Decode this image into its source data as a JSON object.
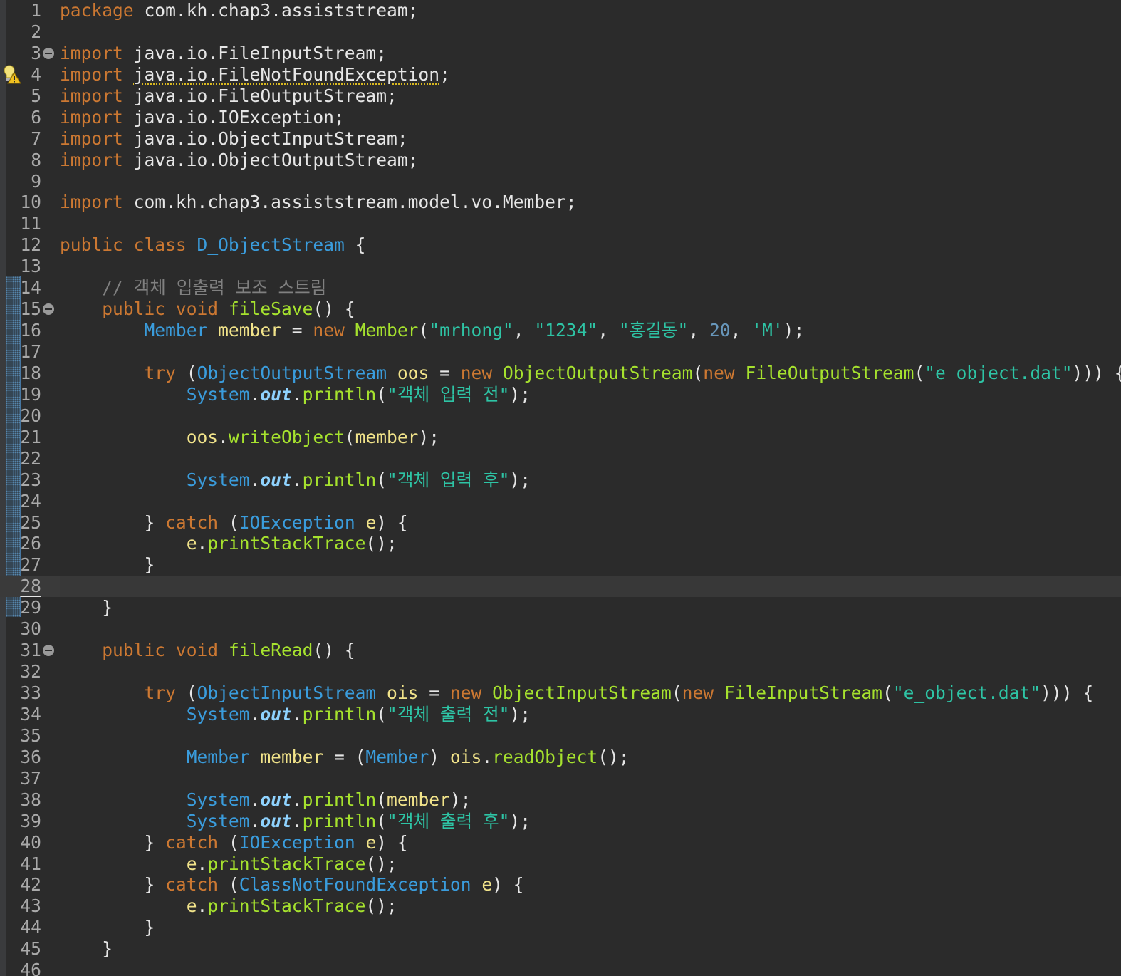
{
  "editor": {
    "language": "java",
    "file_warning_icon": "warning-lightbulb-icon",
    "current_line": 28,
    "folded_lines": [
      3,
      15,
      31
    ],
    "warning_line": 4,
    "colors": {
      "background": "#2b2b2b",
      "keyword": "#cc7832",
      "type": "#3a9cdc",
      "method": "#a6e22e",
      "variable": "#f1e38a",
      "string": "#2ec4a5",
      "number": "#6897bb",
      "comment": "#808080",
      "plain": "#e6e6e6",
      "line_number": "#aaaaaa"
    },
    "lines": [
      {
        "n": "1",
        "tokens": [
          [
            "kw",
            "package"
          ],
          [
            "plain",
            " com.kh.chap3.assiststream;"
          ]
        ]
      },
      {
        "n": "2",
        "tokens": []
      },
      {
        "n": "3",
        "tokens": [
          [
            "kw",
            "import"
          ],
          [
            "plain",
            " java.io.FileInputStream;"
          ]
        ]
      },
      {
        "n": "4",
        "tokens": [
          [
            "kw",
            "import"
          ],
          [
            "plain",
            " "
          ],
          [
            "warn",
            "java.io.FileNotFoundException"
          ],
          [
            "plain",
            ";"
          ]
        ]
      },
      {
        "n": "5",
        "tokens": [
          [
            "kw",
            "import"
          ],
          [
            "plain",
            " java.io.FileOutputStream;"
          ]
        ]
      },
      {
        "n": "6",
        "tokens": [
          [
            "kw",
            "import"
          ],
          [
            "plain",
            " java.io.IOException;"
          ]
        ]
      },
      {
        "n": "7",
        "tokens": [
          [
            "kw",
            "import"
          ],
          [
            "plain",
            " java.io.ObjectInputStream;"
          ]
        ]
      },
      {
        "n": "8",
        "tokens": [
          [
            "kw",
            "import"
          ],
          [
            "plain",
            " java.io.ObjectOutputStream;"
          ]
        ]
      },
      {
        "n": "9",
        "tokens": []
      },
      {
        "n": "10",
        "tokens": [
          [
            "kw",
            "import"
          ],
          [
            "plain",
            " com.kh.chap3.assiststream.model.vo.Member;"
          ]
        ]
      },
      {
        "n": "11",
        "tokens": []
      },
      {
        "n": "12",
        "tokens": [
          [
            "kw",
            "public"
          ],
          [
            "plain",
            " "
          ],
          [
            "kw",
            "class"
          ],
          [
            "plain",
            " "
          ],
          [
            "decl",
            "D_ObjectStream"
          ],
          [
            "plain",
            " {"
          ]
        ]
      },
      {
        "n": "13",
        "tokens": []
      },
      {
        "n": "14",
        "tokens": [
          [
            "plain",
            "    "
          ],
          [
            "comment",
            "// 객체 입출력 보조 스트림"
          ]
        ]
      },
      {
        "n": "15",
        "tokens": [
          [
            "plain",
            "    "
          ],
          [
            "kw",
            "public"
          ],
          [
            "plain",
            " "
          ],
          [
            "kw",
            "void"
          ],
          [
            "plain",
            " "
          ],
          [
            "methoddecl",
            "fileSave"
          ],
          [
            "plain",
            "() {"
          ]
        ]
      },
      {
        "n": "16",
        "tokens": [
          [
            "plain",
            "        "
          ],
          [
            "type",
            "Member"
          ],
          [
            "plain",
            " "
          ],
          [
            "var",
            "member"
          ],
          [
            "plain",
            " = "
          ],
          [
            "kw",
            "new"
          ],
          [
            "plain",
            " "
          ],
          [
            "method",
            "Member"
          ],
          [
            "plain",
            "("
          ],
          [
            "str",
            "\"mrhong\""
          ],
          [
            "plain",
            ", "
          ],
          [
            "str",
            "\"1234\""
          ],
          [
            "plain",
            ", "
          ],
          [
            "str",
            "\"홍길동\""
          ],
          [
            "plain",
            ", "
          ],
          [
            "num",
            "20"
          ],
          [
            "plain",
            ", "
          ],
          [
            "str",
            "'M'"
          ],
          [
            "plain",
            ");"
          ]
        ]
      },
      {
        "n": "17",
        "tokens": []
      },
      {
        "n": "18",
        "tokens": [
          [
            "plain",
            "        "
          ],
          [
            "kw",
            "try"
          ],
          [
            "plain",
            " ("
          ],
          [
            "type",
            "ObjectOutputStream"
          ],
          [
            "plain",
            " "
          ],
          [
            "var",
            "oos"
          ],
          [
            "plain",
            " = "
          ],
          [
            "kw",
            "new"
          ],
          [
            "plain",
            " "
          ],
          [
            "method",
            "ObjectOutputStream"
          ],
          [
            "plain",
            "("
          ],
          [
            "kw",
            "new"
          ],
          [
            "plain",
            " "
          ],
          [
            "method",
            "FileOutputStream"
          ],
          [
            "plain",
            "("
          ],
          [
            "str",
            "\"e_object.dat\""
          ],
          [
            "plain",
            ")))"
          ],
          [
            "plain",
            " {"
          ]
        ]
      },
      {
        "n": "19",
        "tokens": [
          [
            "plain",
            "            "
          ],
          [
            "type",
            "System"
          ],
          [
            "plain",
            "."
          ],
          [
            "field",
            "out"
          ],
          [
            "plain",
            "."
          ],
          [
            "method",
            "println"
          ],
          [
            "plain",
            "("
          ],
          [
            "str",
            "\"객체 입력 전\""
          ],
          [
            "plain",
            ");"
          ]
        ]
      },
      {
        "n": "20",
        "tokens": []
      },
      {
        "n": "21",
        "tokens": [
          [
            "plain",
            "            "
          ],
          [
            "var",
            "oos"
          ],
          [
            "plain",
            "."
          ],
          [
            "method",
            "writeObject"
          ],
          [
            "plain",
            "("
          ],
          [
            "var",
            "member"
          ],
          [
            "plain",
            ");"
          ]
        ]
      },
      {
        "n": "22",
        "tokens": []
      },
      {
        "n": "23",
        "tokens": [
          [
            "plain",
            "            "
          ],
          [
            "type",
            "System"
          ],
          [
            "plain",
            "."
          ],
          [
            "field",
            "out"
          ],
          [
            "plain",
            "."
          ],
          [
            "method",
            "println"
          ],
          [
            "plain",
            "("
          ],
          [
            "str",
            "\"객체 입력 후\""
          ],
          [
            "plain",
            ");"
          ]
        ]
      },
      {
        "n": "24",
        "tokens": []
      },
      {
        "n": "25",
        "tokens": [
          [
            "plain",
            "        } "
          ],
          [
            "kw",
            "catch"
          ],
          [
            "plain",
            " ("
          ],
          [
            "type",
            "IOException"
          ],
          [
            "plain",
            " "
          ],
          [
            "var",
            "e"
          ],
          [
            "plain",
            ") {"
          ]
        ]
      },
      {
        "n": "26",
        "tokens": [
          [
            "plain",
            "            "
          ],
          [
            "var",
            "e"
          ],
          [
            "plain",
            "."
          ],
          [
            "method",
            "printStackTrace"
          ],
          [
            "plain",
            "();"
          ]
        ]
      },
      {
        "n": "27",
        "tokens": [
          [
            "plain",
            "        }"
          ]
        ]
      },
      {
        "n": "28",
        "tokens": []
      },
      {
        "n": "29",
        "tokens": [
          [
            "plain",
            "    }"
          ]
        ]
      },
      {
        "n": "30",
        "tokens": []
      },
      {
        "n": "31",
        "tokens": [
          [
            "plain",
            "    "
          ],
          [
            "kw",
            "public"
          ],
          [
            "plain",
            " "
          ],
          [
            "kw",
            "void"
          ],
          [
            "plain",
            " "
          ],
          [
            "methoddecl",
            "fileRead"
          ],
          [
            "plain",
            "() {"
          ]
        ]
      },
      {
        "n": "32",
        "tokens": []
      },
      {
        "n": "33",
        "tokens": [
          [
            "plain",
            "        "
          ],
          [
            "kw",
            "try"
          ],
          [
            "plain",
            " ("
          ],
          [
            "type",
            "ObjectInputStream"
          ],
          [
            "plain",
            " "
          ],
          [
            "var",
            "ois"
          ],
          [
            "plain",
            " = "
          ],
          [
            "kw",
            "new"
          ],
          [
            "plain",
            " "
          ],
          [
            "method",
            "ObjectInputStream"
          ],
          [
            "plain",
            "("
          ],
          [
            "kw",
            "new"
          ],
          [
            "plain",
            " "
          ],
          [
            "method",
            "FileInputStream"
          ],
          [
            "plain",
            "("
          ],
          [
            "str",
            "\"e_object.dat\""
          ],
          [
            "plain",
            ")))"
          ],
          [
            "plain",
            " {"
          ]
        ]
      },
      {
        "n": "34",
        "tokens": [
          [
            "plain",
            "            "
          ],
          [
            "type",
            "System"
          ],
          [
            "plain",
            "."
          ],
          [
            "field",
            "out"
          ],
          [
            "plain",
            "."
          ],
          [
            "method",
            "println"
          ],
          [
            "plain",
            "("
          ],
          [
            "str",
            "\"객체 출력 전\""
          ],
          [
            "plain",
            ");"
          ]
        ]
      },
      {
        "n": "35",
        "tokens": []
      },
      {
        "n": "36",
        "tokens": [
          [
            "plain",
            "            "
          ],
          [
            "type",
            "Member"
          ],
          [
            "plain",
            " "
          ],
          [
            "var",
            "member"
          ],
          [
            "plain",
            " = ("
          ],
          [
            "type",
            "Member"
          ],
          [
            "plain",
            ") "
          ],
          [
            "var",
            "ois"
          ],
          [
            "plain",
            "."
          ],
          [
            "method",
            "readObject"
          ],
          [
            "plain",
            "();"
          ]
        ]
      },
      {
        "n": "37",
        "tokens": []
      },
      {
        "n": "38",
        "tokens": [
          [
            "plain",
            "            "
          ],
          [
            "type",
            "System"
          ],
          [
            "plain",
            "."
          ],
          [
            "field",
            "out"
          ],
          [
            "plain",
            "."
          ],
          [
            "method",
            "println"
          ],
          [
            "plain",
            "("
          ],
          [
            "var",
            "member"
          ],
          [
            "plain",
            ");"
          ]
        ]
      },
      {
        "n": "39",
        "tokens": [
          [
            "plain",
            "            "
          ],
          [
            "type",
            "System"
          ],
          [
            "plain",
            "."
          ],
          [
            "field",
            "out"
          ],
          [
            "plain",
            "."
          ],
          [
            "method",
            "println"
          ],
          [
            "plain",
            "("
          ],
          [
            "str",
            "\"객체 출력 후\""
          ],
          [
            "plain",
            ");"
          ]
        ]
      },
      {
        "n": "40",
        "tokens": [
          [
            "plain",
            "        } "
          ],
          [
            "kw",
            "catch"
          ],
          [
            "plain",
            " ("
          ],
          [
            "type",
            "IOException"
          ],
          [
            "plain",
            " "
          ],
          [
            "var",
            "e"
          ],
          [
            "plain",
            ") {"
          ]
        ]
      },
      {
        "n": "41",
        "tokens": [
          [
            "plain",
            "            "
          ],
          [
            "var",
            "e"
          ],
          [
            "plain",
            "."
          ],
          [
            "method",
            "printStackTrace"
          ],
          [
            "plain",
            "();"
          ]
        ]
      },
      {
        "n": "42",
        "tokens": [
          [
            "plain",
            "        } "
          ],
          [
            "kw",
            "catch"
          ],
          [
            "plain",
            " ("
          ],
          [
            "type",
            "ClassNotFoundException"
          ],
          [
            "plain",
            " "
          ],
          [
            "var",
            "e"
          ],
          [
            "plain",
            ") {"
          ]
        ]
      },
      {
        "n": "43",
        "tokens": [
          [
            "plain",
            "            "
          ],
          [
            "var",
            "e"
          ],
          [
            "plain",
            "."
          ],
          [
            "method",
            "printStackTrace"
          ],
          [
            "plain",
            "();"
          ]
        ]
      },
      {
        "n": "44",
        "tokens": [
          [
            "plain",
            "        }"
          ]
        ]
      },
      {
        "n": "45",
        "tokens": [
          [
            "plain",
            "    }"
          ]
        ]
      },
      {
        "n": "46",
        "tokens": []
      }
    ]
  }
}
